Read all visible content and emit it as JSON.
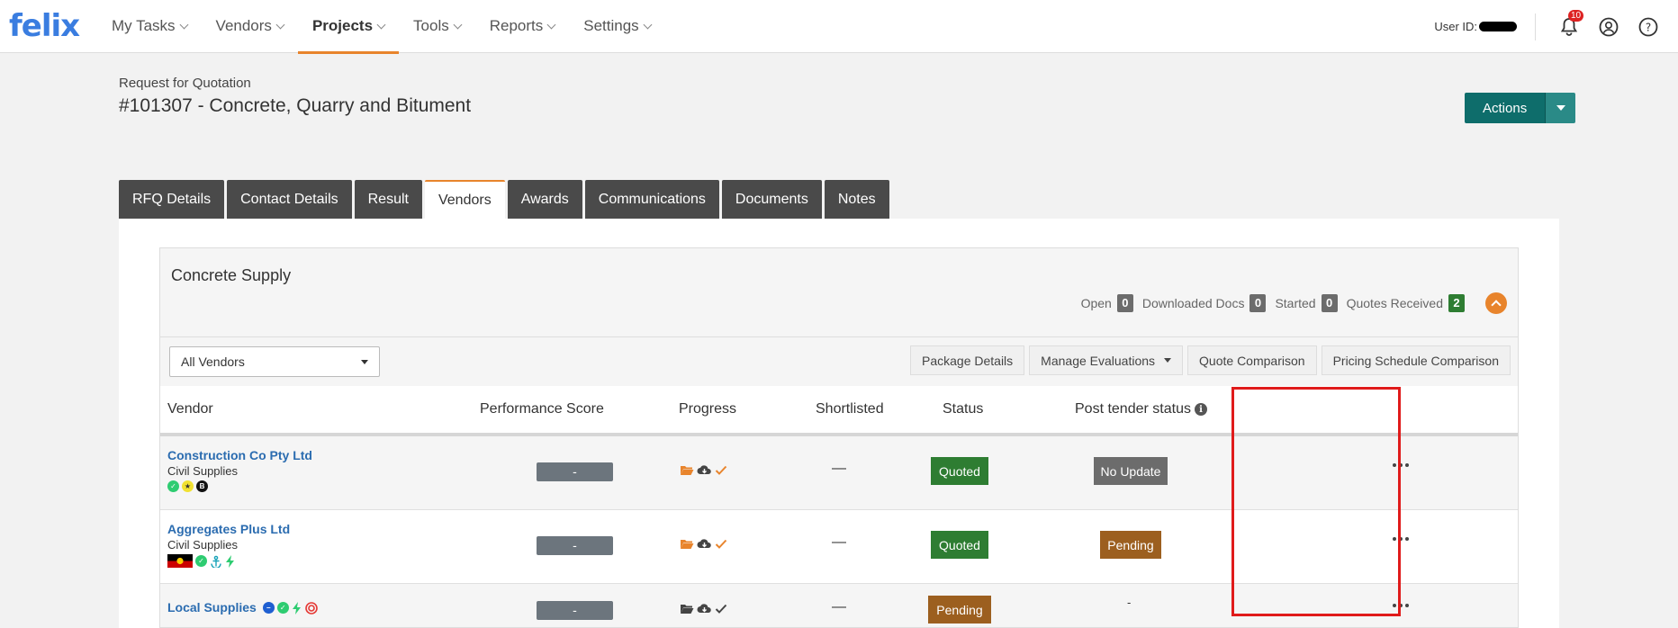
{
  "brand": {
    "logo": "felix",
    "accent": "#e8842c",
    "link_color": "#2b6cb0"
  },
  "nav": {
    "items": [
      {
        "label": "My Tasks",
        "active": false
      },
      {
        "label": "Vendors",
        "active": false
      },
      {
        "label": "Projects",
        "active": true
      },
      {
        "label": "Tools",
        "active": false
      },
      {
        "label": "Reports",
        "active": false
      },
      {
        "label": "Settings",
        "active": false
      }
    ],
    "user_label": "User ID:",
    "notification_count": "10",
    "icons": [
      "bell-icon",
      "user-circle-icon",
      "help-icon"
    ]
  },
  "header": {
    "subtitle": "Request for Quotation",
    "title": "#101307 - Concrete, Quarry and Bitument",
    "actions_label": "Actions"
  },
  "tabs": [
    {
      "label": "RFQ Details",
      "active": false
    },
    {
      "label": "Contact Details",
      "active": false
    },
    {
      "label": "Result",
      "active": false
    },
    {
      "label": "Vendors",
      "active": true
    },
    {
      "label": "Awards",
      "active": false
    },
    {
      "label": "Communications",
      "active": false
    },
    {
      "label": "Documents",
      "active": false
    },
    {
      "label": "Notes",
      "active": false
    }
  ],
  "package": {
    "title": "Concrete Supply",
    "counts": {
      "open_label": "Open",
      "open": "0",
      "downloaded_label": "Downloaded Docs",
      "downloaded": "0",
      "started_label": "Started",
      "started": "0",
      "quotes_label": "Quotes Received",
      "quotes": "2"
    },
    "filter": {
      "selected": "All Vendors"
    },
    "toolbar": {
      "package_details": "Package Details",
      "manage_evaluations": "Manage Evaluations",
      "quote_comparison": "Quote Comparison",
      "pricing_schedule": "Pricing Schedule Comparison"
    }
  },
  "table": {
    "headers": {
      "vendor": "Vendor",
      "performance": "Performance Score",
      "progress": "Progress",
      "shortlisted": "Shortlisted",
      "status": "Status",
      "post_tender": "Post tender status"
    },
    "rows": [
      {
        "name": "Construction Co Pty Ltd",
        "category": "Civil Supplies",
        "score": "-",
        "shortlisted": "—",
        "status": "Quoted",
        "status_color": "#2e7d32",
        "post_tender": "No Update",
        "post_tender_color": "#6c6c6c"
      },
      {
        "name": "Aggregates Plus Ltd",
        "category": "Civil Supplies",
        "score": "-",
        "shortlisted": "—",
        "status": "Quoted",
        "status_color": "#2e7d32",
        "post_tender": "Pending",
        "post_tender_color": "#9c5f1f"
      },
      {
        "name": "Local Supplies",
        "category": "",
        "score": "-",
        "shortlisted": "—",
        "status": "Pending",
        "status_color": "#9c5f1f",
        "post_tender": "-",
        "post_tender_color": ""
      }
    ]
  }
}
